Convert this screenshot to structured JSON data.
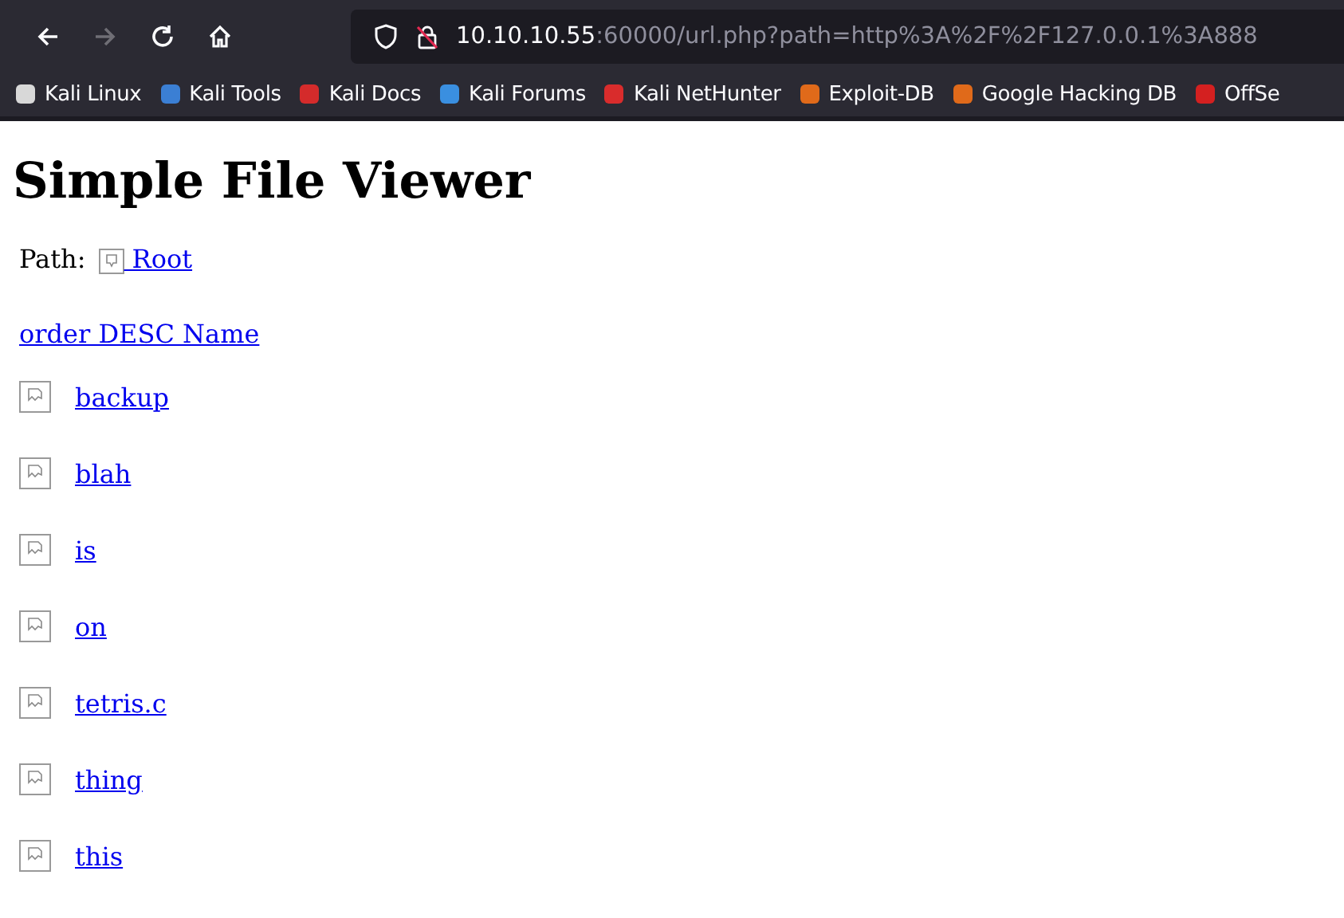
{
  "toolbar": {
    "back": {
      "disabled": false
    },
    "forward": {
      "disabled": true
    },
    "url": {
      "host": "10.10.10.55",
      "rest": ":60000/url.php?path=http%3A%2F%2F127.0.0.1%3A888"
    }
  },
  "bookmarks": [
    {
      "label": "Kali Linux",
      "color": "#d8d8d8"
    },
    {
      "label": "Kali Tools",
      "color": "#3b7fd4"
    },
    {
      "label": "Kali Docs",
      "color": "#d42b2b"
    },
    {
      "label": "Kali Forums",
      "color": "#3a8fe0"
    },
    {
      "label": "Kali NetHunter",
      "color": "#d92c2c"
    },
    {
      "label": "Exploit-DB",
      "color": "#e06a1a"
    },
    {
      "label": "Google Hacking DB",
      "color": "#e06a1a"
    },
    {
      "label": "OffSe",
      "color": "#d42020"
    }
  ],
  "page": {
    "title": "Simple File Viewer",
    "path_label": "Path:",
    "root_link": " Root",
    "order_link": "order DESC Name",
    "files": [
      {
        "name": "backup"
      },
      {
        "name": "blah"
      },
      {
        "name": "is"
      },
      {
        "name": "on"
      },
      {
        "name": "tetris.c"
      },
      {
        "name": "thing"
      },
      {
        "name": "this"
      }
    ]
  }
}
